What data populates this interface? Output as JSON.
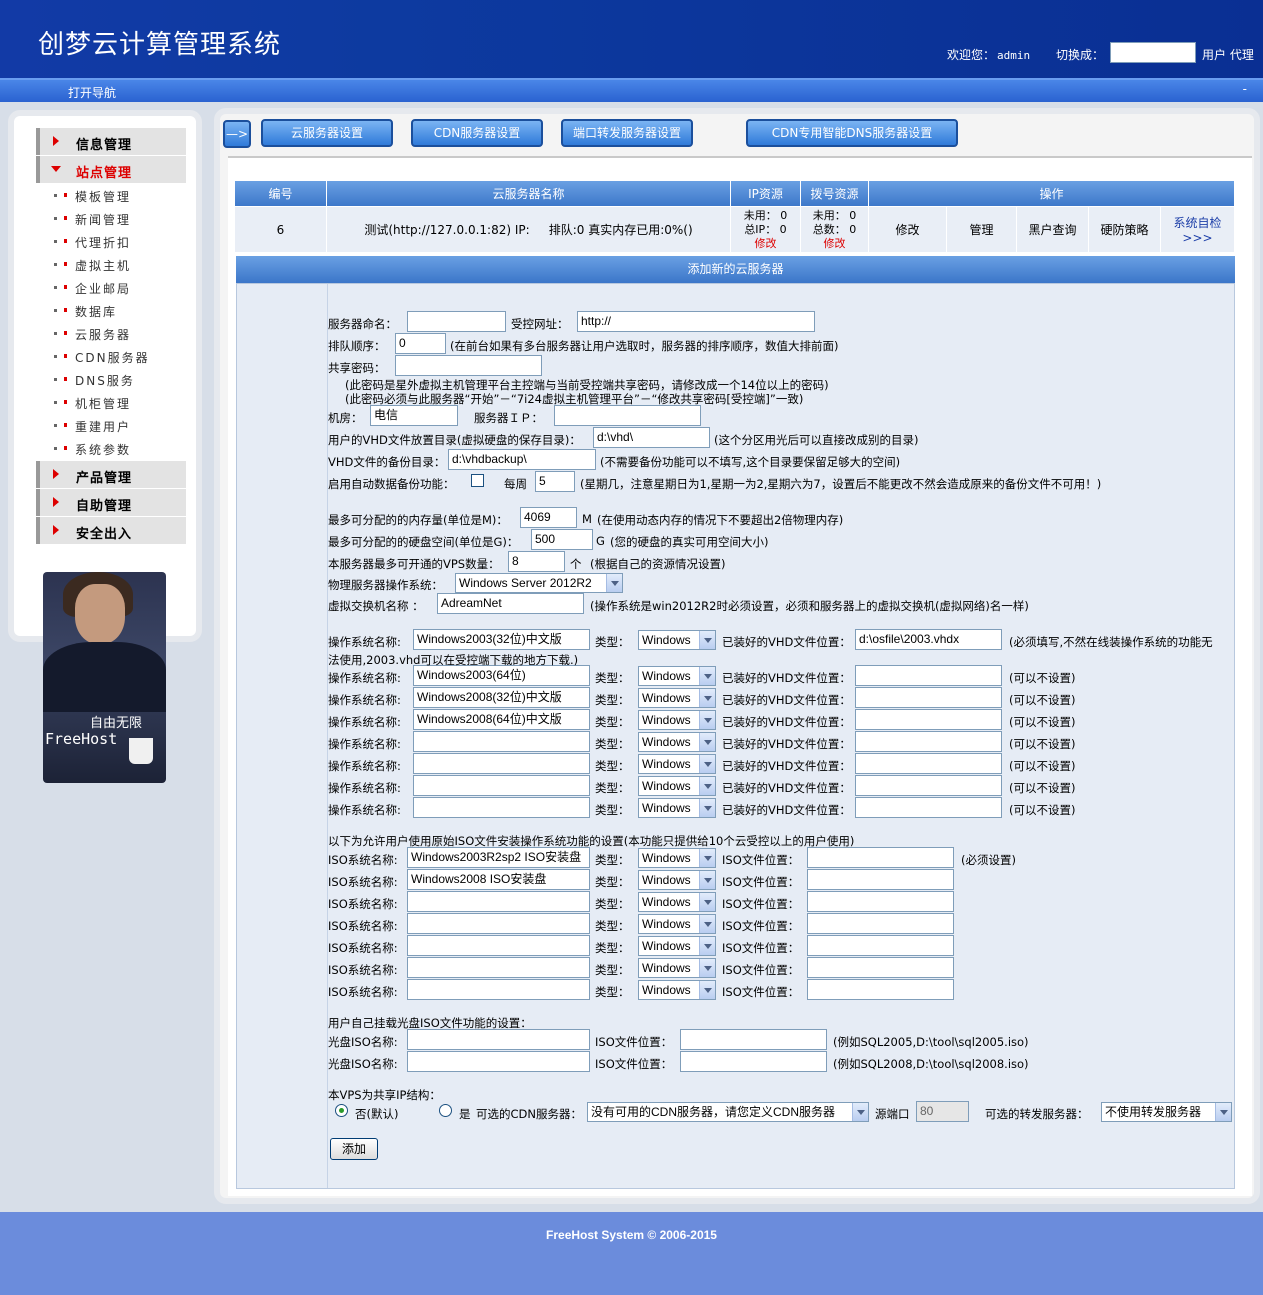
{
  "header": {
    "title": "创梦云计算管理系统",
    "welcome_label": "欢迎您：",
    "username": "admin",
    "switch_label": "切换成：",
    "switch_options": "用户 代理"
  },
  "navbar": {
    "toggle": "打开导航",
    "collapse": "-"
  },
  "sidebar": {
    "groups": [
      {
        "label": "信息管理"
      },
      {
        "label": "站点管理"
      },
      {
        "label": "产品管理"
      },
      {
        "label": "自助管理"
      },
      {
        "label": "安全出入"
      }
    ],
    "items": [
      "模板管理",
      "新闻管理",
      "代理折扣",
      "虚拟主机",
      "企业邮局",
      "数据库",
      "云服务器",
      "CDN服务器",
      "DNS服务",
      "机柜管理",
      "重建用户",
      "系统参数"
    ],
    "promo": {
      "slogan": "自由无限",
      "brand": "FreeHost"
    }
  },
  "tabs": {
    "arrow": "—>",
    "items": [
      "云服务器设置",
      "CDN服务器设置",
      "端口转发服务器设置",
      "CDN专用智能DNS服务器设置"
    ]
  },
  "table": {
    "headers": [
      "编号",
      "云服务器名称",
      "IP资源",
      "拨号资源",
      "操作"
    ],
    "row": {
      "id": "6",
      "name": "测试(http://127.0.0.1:82) IP:",
      "queue": "排队:0 真实内存已用:0%()",
      "ip_used": "未用： 0",
      "ip_total": "总IP： 0",
      "ip_edit": "修改",
      "dial_used": "未用： 0",
      "dial_total": "总数： 0",
      "dial_edit": "修改",
      "actions": [
        "修改",
        "管理",
        "黑户查询",
        "硬防策略",
        "系统自检>>>"
      ]
    }
  },
  "form": {
    "title": "添加新的云服务器",
    "server_name_label": "服务器命名：",
    "server_name": "",
    "control_url_label": "受控网址：",
    "control_url": "http://",
    "order_label": "排队顺序：",
    "order": "0",
    "order_hint": "(在前台如果有多台服务器让用户选取时，服务器的排序顺序，数值大排前面)",
    "secret_label": "共享密码：",
    "secret": "",
    "secret_hint1": "(此密码是星外虚拟主机管理平台主控端与当前受控端共享密码，请修改成一个14位以上的密码)",
    "secret_hint2": "(此密码必须与此服务器“开始”－“7i24虚拟主机管理平台”－“修改共享密码[受控端]”一致)",
    "room_label": "机房：",
    "room": "电信",
    "ip_label": "服务器ＩＰ：",
    "ip": "",
    "vhd_dir_label": "用户的VHD文件放置目录(虚拟硬盘的保存目录)：",
    "vhd_dir": "d:\\vhd\\",
    "vhd_dir_hint": "(这个分区用光后可以直接改成别的目录)",
    "backup_dir_label": "VHD文件的备份目录：",
    "backup_dir": "d:\\vhdbackup\\",
    "backup_dir_hint": "(不需要备份功能可以不填写,这个目录要保留足够大的空间)",
    "auto_backup_label": "启用自动数据备份功能：",
    "weekly_label": "每周",
    "weekday": "5",
    "weekday_hint": "(星期几，注意星期日为1,星期一为2,星期六为7，设置后不能更改不然会造成原来的备份文件不可用！)",
    "mem_label": "最多可分配的的内存量(单位是M)：",
    "mem": "4069",
    "mem_unit": "M",
    "mem_hint": "(在使用动态内存的情况下不要超出2倍物理内存)",
    "disk_label": "最多可分配的的硬盘空间(单位是G)：",
    "disk": "500",
    "disk_unit": "G",
    "disk_hint": "(您的硬盘的真实可用空间大小)",
    "vps_label": "本服务器最多可开通的VPS数量：",
    "vps": "8",
    "vps_unit": "个",
    "vps_hint": "(根据自己的资源情况设置)",
    "os_label": "物理服务器操作系统：",
    "os": "Windows Server 2012R2",
    "switch_label": "虚拟交换机名称 ：",
    "switch_name": "AdreamNet",
    "switch_hint": "(操作系统是win2012R2时必须设置，必须和服务器上的虚拟交换机(虚拟网络)名一样)",
    "os_name_label": "操作系统名称:",
    "type_label": "类型：",
    "vhd_file_label": "已装好的VHD文件位置：",
    "os_rows": [
      {
        "name": "Windows2003(32位)中文版",
        "type": "Windows",
        "file": "d:\\osfile\\2003.vhdx",
        "hint": "(必须填写,不然在线装操作系统的功能无"
      },
      {
        "name": "Windows2003(64位)",
        "type": "Windows",
        "file": "",
        "hint": "(可以不设置)"
      },
      {
        "name": "Windows2008(32位)中文版",
        "type": "Windows",
        "file": "",
        "hint": "(可以不设置)"
      },
      {
        "name": "Windows2008(64位)中文版",
        "type": "Windows",
        "file": "",
        "hint": "(可以不设置)"
      },
      {
        "name": "",
        "type": "Windows",
        "file": "",
        "hint": "(可以不设置)"
      },
      {
        "name": "",
        "type": "Windows",
        "file": "",
        "hint": "(可以不设置)"
      },
      {
        "name": "",
        "type": "Windows",
        "file": "",
        "hint": "(可以不设置)"
      },
      {
        "name": "",
        "type": "Windows",
        "file": "",
        "hint": "(可以不设置)"
      }
    ],
    "os_row1_wrap": "法使用,2003.vhd可以在受控端下载的地方下载.)",
    "iso_intro": "以下为允许用户使用原始ISO文件安装操作系统功能的设置(本功能只提供给10个云受控以上的用户使用)",
    "iso_name_label": "ISO系统名称:",
    "iso_file_label": "ISO文件位置：",
    "iso_rows": [
      {
        "name": "Windows2003R2sp2 ISO安装盘",
        "type": "Windows",
        "file": "",
        "hint": "(必须设置)"
      },
      {
        "name": "Windows2008 ISO安装盘",
        "type": "Windows",
        "file": "",
        "hint": ""
      },
      {
        "name": "",
        "type": "Windows",
        "file": "",
        "hint": ""
      },
      {
        "name": "",
        "type": "Windows",
        "file": "",
        "hint": ""
      },
      {
        "name": "",
        "type": "Windows",
        "file": "",
        "hint": ""
      },
      {
        "name": "",
        "type": "Windows",
        "file": "",
        "hint": ""
      },
      {
        "name": "",
        "type": "Windows",
        "file": "",
        "hint": ""
      }
    ],
    "cd_intro": "用户自己挂载光盘ISO文件功能的设置：",
    "cd_name_label": "光盘ISO名称:",
    "cd_rows": [
      {
        "name": "",
        "file": "",
        "hint": "(例如SQL2005,D:\\tool\\sql2005.iso)"
      },
      {
        "name": "",
        "file": "",
        "hint": "(例如SQL2008,D:\\tool\\sql2008.iso)"
      }
    ],
    "shared_ip_label": "本VPS为共享IP结构：",
    "no_label": "否(默认)",
    "yes_label": "是",
    "cdn_label": "可选的CDN服务器：",
    "cdn_value": "没有可用的CDN服务器，请您定义CDN服务器",
    "src_port_label": "源端口",
    "src_port": "80",
    "fwd_label": "可选的转发服务器：",
    "fwd_value": "不使用转发服务器",
    "submit": "添加"
  },
  "footer": {
    "text": "FreeHost System © 2006-2015"
  }
}
